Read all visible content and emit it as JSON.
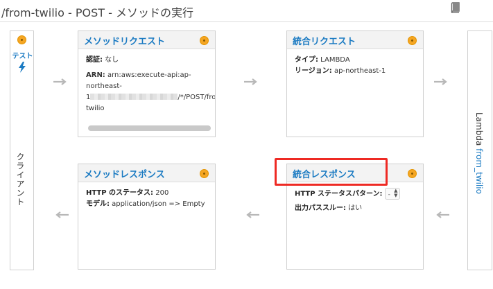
{
  "page": {
    "title": "/from-twilio - POST - メソッドの実行",
    "doc_icon": "book-icon"
  },
  "client": {
    "test_label": "テスト",
    "label": "クライアント",
    "test_icon": "lightning-bolt-icon"
  },
  "lambda": {
    "prefix": "Lambda ",
    "function": "from_twilio"
  },
  "method_request": {
    "title": "メソッドリクエスト",
    "auth_label": "認証:",
    "auth_value": " なし",
    "arn_label": "ARN:",
    "arn_value_1": " arn:aws:execute-api:ap-",
    "arn_value_2": "northeast-",
    "arn_value_3_prefix": "1",
    "arn_value_3_suffix": "/*/POST/from",
    "arn_value_4": "twilio"
  },
  "integration_request": {
    "title": "統合リクエスト",
    "type_label": "タイプ:",
    "type_value": " LAMBDA",
    "region_label": "リージョン:",
    "region_value": " ap-northeast-1"
  },
  "method_response": {
    "title": "メソッドレスポンス",
    "status_label": "HTTP のステータス:",
    "status_value": " 200",
    "model_label": "モデル:",
    "model_value": " application/json => Empty"
  },
  "integration_response": {
    "title": "統合レスポンス",
    "pattern_label": "HTTP ステータスパターン:",
    "pattern_value": "-",
    "passthrough_label": "出力パススルー:",
    "passthrough_value": " はい"
  },
  "colors": {
    "link": "#1a7ac2",
    "dot": "#f5a623",
    "highlight": "#ee2a24",
    "arrow": "#b8b8b8"
  }
}
